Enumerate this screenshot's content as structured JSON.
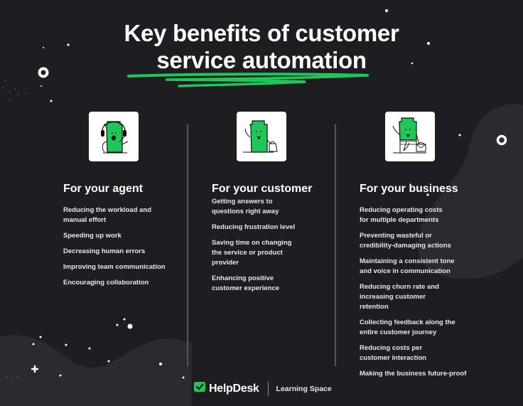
{
  "title": {
    "line1": "Key benefits of customer",
    "line2": "service automation"
  },
  "colors": {
    "background": "#1e1e22",
    "blob": "#2a2a30",
    "accent_green": "#1fc65a",
    "text": "#ffffff"
  },
  "columns": [
    {
      "heading": "For your agent",
      "icon": "agent-with-headset-icon",
      "items": [
        "Reducing the workload and manual effort",
        "Speeding up work",
        "Decreasing human errors",
        "Improving team communication",
        "Encouraging collaboration"
      ]
    },
    {
      "heading": "For your customer",
      "icon": "customer-with-shopping-bag-icon",
      "items": [
        "Getting answers to questions right away",
        "Reducing frustration level",
        "Saving time on changing the service or product provider",
        "Enhancing positive customer experience"
      ]
    },
    {
      "heading": "For your business",
      "icon": "businessman-with-briefcase-icon",
      "items": [
        "Reducing operating costs for multiple departments",
        "Preventing wasteful or credibility-damaging actions",
        "Maintaining a consistent tone and voice in communication",
        "Reducing churn rate and increasing customer retention",
        "Collecting feedback along the entire customer journey",
        "Reducing costs per customer interaction",
        "Making the business future-proof"
      ]
    }
  ],
  "footer": {
    "brand": "HelpDesk",
    "section": "Learning Space"
  }
}
